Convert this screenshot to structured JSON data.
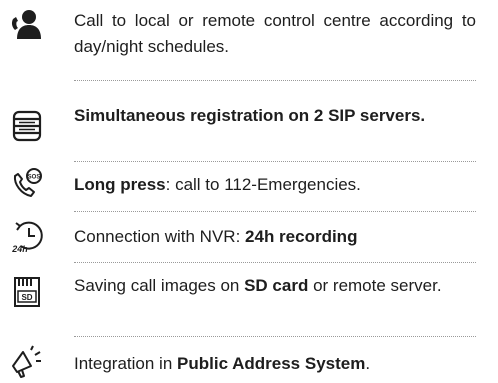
{
  "features": [
    {
      "icon": "operator-headset-icon",
      "parts": [
        {
          "t": "Call to local or remote control centre according to day/night schedules.",
          "bold": false
        }
      ]
    },
    {
      "icon": "server-stack-icon",
      "parts": [
        {
          "t": "Simultaneous registration on 2 SIP servers.",
          "bold": true
        }
      ]
    },
    {
      "icon": "sos-phone-icon",
      "parts": [
        {
          "t": "Long press",
          "bold": true
        },
        {
          "t": ": call to 112-Emergencies.",
          "bold": false
        }
      ]
    },
    {
      "icon": "24h-recording-icon",
      "parts": [
        {
          "t": "Connection with NVR: ",
          "bold": false
        },
        {
          "t": "24h recording",
          "bold": true
        }
      ]
    },
    {
      "icon": "sd-card-icon",
      "parts": [
        {
          "t": "Saving call images on ",
          "bold": false
        },
        {
          "t": "SD card",
          "bold": true
        },
        {
          "t": " or remote server.",
          "bold": false
        }
      ]
    },
    {
      "icon": "megaphone-icon",
      "parts": [
        {
          "t": "Integration in ",
          "bold": false
        },
        {
          "t": "Public Address System",
          "bold": true
        },
        {
          "t": ".",
          "bold": false
        }
      ]
    }
  ]
}
